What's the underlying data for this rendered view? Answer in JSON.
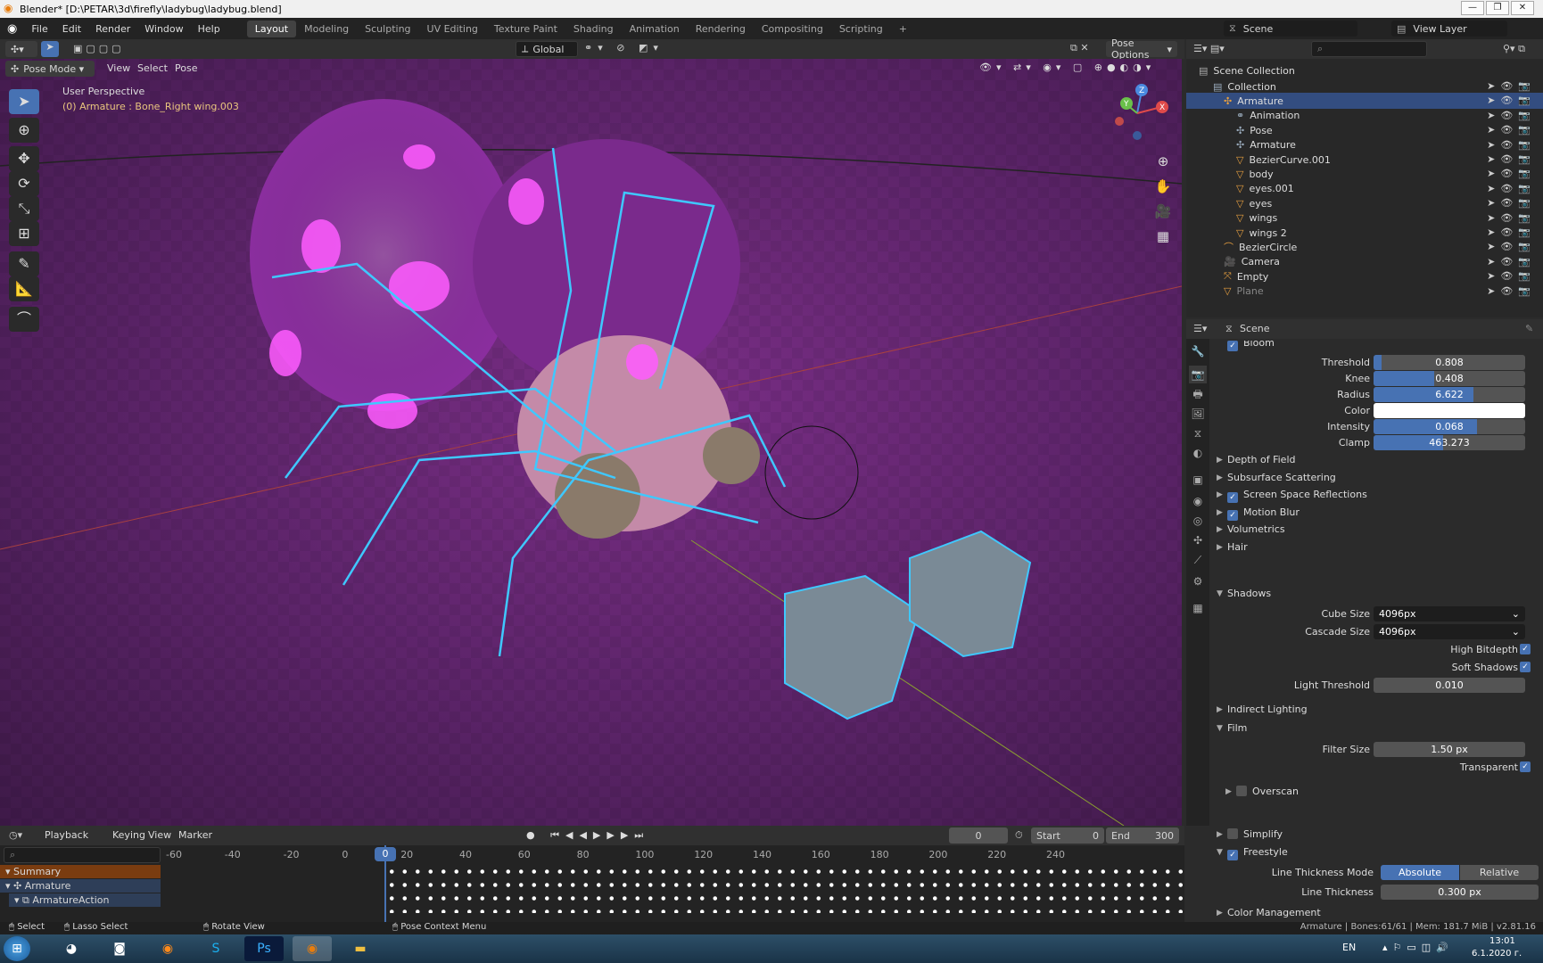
{
  "window": {
    "title": "Blender* [D:\\PETAR\\3d\\firefly\\ladybug\\ladybug.blend]",
    "controls": [
      "—",
      "❐",
      "✕"
    ]
  },
  "menus": [
    "File",
    "Edit",
    "Render",
    "Window",
    "Help"
  ],
  "workspaces": [
    "Layout",
    "Modeling",
    "Sculpting",
    "UV Editing",
    "Texture Paint",
    "Shading",
    "Animation",
    "Rendering",
    "Compositing",
    "Scripting"
  ],
  "active_workspace": "Layout",
  "scene_selector": "Scene",
  "view_layer_selector": "View Layer",
  "viewport": {
    "mode": "Pose Mode",
    "menus": [
      "View",
      "Select",
      "Pose"
    ],
    "orientation": "Global",
    "pose_options": "Pose Options",
    "perspective_label": "User Perspective",
    "active_bone_label": "(0) Armature : Bone_Right wing.003",
    "gizmo_axes": {
      "x": "X",
      "y": "Y",
      "z": "Z"
    }
  },
  "outliner": {
    "root": "Scene Collection",
    "rows": [
      {
        "label": "Collection",
        "icon": "collection-icon"
      },
      {
        "label": "Armature",
        "icon": "armature-icon"
      },
      {
        "label": "Animation",
        "icon": "animation-icon"
      },
      {
        "label": "Pose",
        "icon": "pose-icon"
      },
      {
        "label": "Armature",
        "icon": "armature-data-icon"
      },
      {
        "label": "BezierCurve.001",
        "icon": "mesh-icon"
      },
      {
        "label": "body",
        "icon": "mesh-icon"
      },
      {
        "label": "eyes.001",
        "icon": "mesh-icon"
      },
      {
        "label": "eyes",
        "icon": "mesh-icon"
      },
      {
        "label": "wings",
        "icon": "mesh-icon"
      },
      {
        "label": "wings 2",
        "icon": "mesh-icon"
      },
      {
        "label": "BezierCircle",
        "icon": "curve-icon"
      },
      {
        "label": "Camera",
        "icon": "camera-icon"
      },
      {
        "label": "Empty",
        "icon": "empty-icon"
      },
      {
        "label": "Plane",
        "icon": "mesh-icon"
      }
    ]
  },
  "properties": {
    "context": "Scene",
    "bloom_header": "Bloom",
    "bloom": [
      {
        "label": "Threshold",
        "value": "0.808",
        "fill": 0.05
      },
      {
        "label": "Knee",
        "value": "0.408",
        "fill": 0.4
      },
      {
        "label": "Radius",
        "value": "6.622",
        "fill": 0.66
      },
      {
        "label": "Color",
        "value": "",
        "fill": 0
      },
      {
        "label": "Intensity",
        "value": "0.068",
        "fill": 0.68
      },
      {
        "label": "Clamp",
        "value": "463.273",
        "fill": 0.46
      }
    ],
    "sections1": [
      {
        "label": "Depth of Field",
        "checkbox": null
      },
      {
        "label": "Subsurface Scattering",
        "checkbox": null
      },
      {
        "label": "Screen Space Reflections",
        "checkbox": true
      },
      {
        "label": "Motion Blur",
        "checkbox": true
      },
      {
        "label": "Volumetrics",
        "checkbox": null
      },
      {
        "label": "Hair",
        "checkbox": null
      }
    ],
    "shadows": {
      "header": "Shadows",
      "cube_size_label": "Cube Size",
      "cube_size": "4096px",
      "cascade_label": "Cascade Size",
      "cascade": "4096px",
      "high_bitdepth": "High Bitdepth",
      "soft_shadows": "Soft Shadows",
      "light_threshold_label": "Light Threshold",
      "light_threshold": "0.010"
    },
    "indirect": "Indirect Lighting",
    "film": {
      "header": "Film",
      "filter_label": "Filter Size",
      "filter": "1.50 px",
      "transparent": "Transparent",
      "overscan": "Overscan"
    },
    "simplify": "Simplify",
    "freestyle": {
      "header": "Freestyle",
      "mode_label": "Line Thickness Mode",
      "mode_a": "Absolute",
      "mode_b": "Relative",
      "thick_label": "Line Thickness",
      "thick": "0.300 px"
    },
    "color_mgmt": "Color Management"
  },
  "timeline": {
    "menus": [
      "Playback",
      "Keying",
      "View",
      "Marker"
    ],
    "current_frame": "0",
    "start_label": "Start",
    "start": "0",
    "end_label": "End",
    "end": "300",
    "ticks": [
      "-60",
      "-40",
      "-20",
      "0",
      "20",
      "40",
      "60",
      "80",
      "100",
      "120",
      "140",
      "160",
      "180",
      "200",
      "220",
      "240"
    ],
    "channels": [
      "Summary",
      "Armature",
      "ArmatureAction"
    ]
  },
  "status": {
    "select": "Select",
    "lasso": "Lasso Select",
    "rotate": "Rotate View",
    "context": "Pose Context Menu",
    "info": "Armature | Bones:61/61 | Mem: 181.7 MiB | v2.81.16"
  },
  "taskbar": {
    "lang": "EN",
    "time": "13:01",
    "date": "6.1.2020 г."
  }
}
